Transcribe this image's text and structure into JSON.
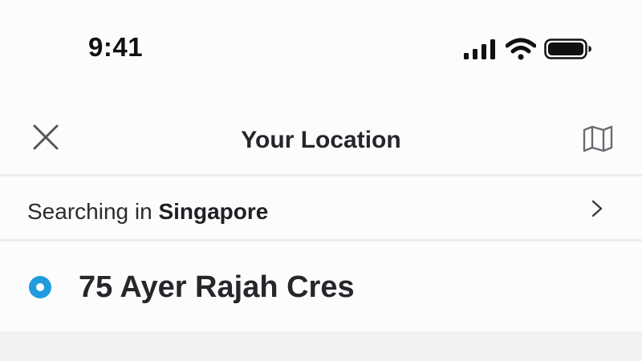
{
  "status_bar": {
    "time": "9:41",
    "icons": [
      "cellular-signal-icon",
      "wifi-icon",
      "battery-icon"
    ]
  },
  "header": {
    "title": "Your Location",
    "left_icon": "close-icon",
    "right_icon": "map-icon"
  },
  "search_row": {
    "prefix": "Searching in",
    "country": "Singapore",
    "icon": "chevron-right-icon"
  },
  "location": {
    "address": "75 Ayer Rajah Cres",
    "icon": "current-location-dot-icon"
  },
  "colors": {
    "accent": "#1f9bde",
    "text": "#26262b",
    "divider": "#ececef",
    "background": "#fdfcfd"
  }
}
